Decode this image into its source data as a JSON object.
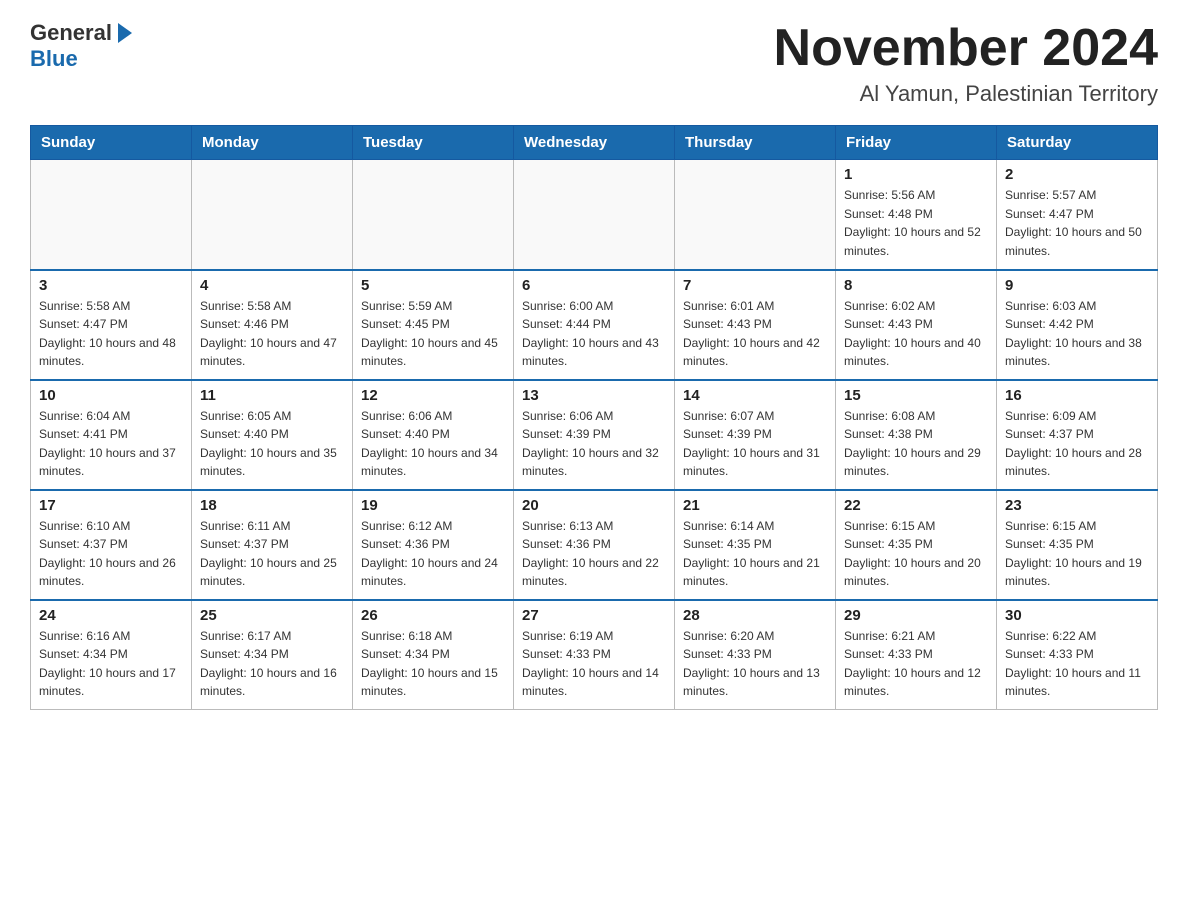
{
  "header": {
    "logo_text": "General",
    "logo_blue": "Blue",
    "month": "November 2024",
    "location": "Al Yamun, Palestinian Territory"
  },
  "days_of_week": [
    "Sunday",
    "Monday",
    "Tuesday",
    "Wednesday",
    "Thursday",
    "Friday",
    "Saturday"
  ],
  "weeks": [
    [
      {
        "day": "",
        "sunrise": "",
        "sunset": "",
        "daylight": ""
      },
      {
        "day": "",
        "sunrise": "",
        "sunset": "",
        "daylight": ""
      },
      {
        "day": "",
        "sunrise": "",
        "sunset": "",
        "daylight": ""
      },
      {
        "day": "",
        "sunrise": "",
        "sunset": "",
        "daylight": ""
      },
      {
        "day": "",
        "sunrise": "",
        "sunset": "",
        "daylight": ""
      },
      {
        "day": "1",
        "sunrise": "Sunrise: 5:56 AM",
        "sunset": "Sunset: 4:48 PM",
        "daylight": "Daylight: 10 hours and 52 minutes."
      },
      {
        "day": "2",
        "sunrise": "Sunrise: 5:57 AM",
        "sunset": "Sunset: 4:47 PM",
        "daylight": "Daylight: 10 hours and 50 minutes."
      }
    ],
    [
      {
        "day": "3",
        "sunrise": "Sunrise: 5:58 AM",
        "sunset": "Sunset: 4:47 PM",
        "daylight": "Daylight: 10 hours and 48 minutes."
      },
      {
        "day": "4",
        "sunrise": "Sunrise: 5:58 AM",
        "sunset": "Sunset: 4:46 PM",
        "daylight": "Daylight: 10 hours and 47 minutes."
      },
      {
        "day": "5",
        "sunrise": "Sunrise: 5:59 AM",
        "sunset": "Sunset: 4:45 PM",
        "daylight": "Daylight: 10 hours and 45 minutes."
      },
      {
        "day": "6",
        "sunrise": "Sunrise: 6:00 AM",
        "sunset": "Sunset: 4:44 PM",
        "daylight": "Daylight: 10 hours and 43 minutes."
      },
      {
        "day": "7",
        "sunrise": "Sunrise: 6:01 AM",
        "sunset": "Sunset: 4:43 PM",
        "daylight": "Daylight: 10 hours and 42 minutes."
      },
      {
        "day": "8",
        "sunrise": "Sunrise: 6:02 AM",
        "sunset": "Sunset: 4:43 PM",
        "daylight": "Daylight: 10 hours and 40 minutes."
      },
      {
        "day": "9",
        "sunrise": "Sunrise: 6:03 AM",
        "sunset": "Sunset: 4:42 PM",
        "daylight": "Daylight: 10 hours and 38 minutes."
      }
    ],
    [
      {
        "day": "10",
        "sunrise": "Sunrise: 6:04 AM",
        "sunset": "Sunset: 4:41 PM",
        "daylight": "Daylight: 10 hours and 37 minutes."
      },
      {
        "day": "11",
        "sunrise": "Sunrise: 6:05 AM",
        "sunset": "Sunset: 4:40 PM",
        "daylight": "Daylight: 10 hours and 35 minutes."
      },
      {
        "day": "12",
        "sunrise": "Sunrise: 6:06 AM",
        "sunset": "Sunset: 4:40 PM",
        "daylight": "Daylight: 10 hours and 34 minutes."
      },
      {
        "day": "13",
        "sunrise": "Sunrise: 6:06 AM",
        "sunset": "Sunset: 4:39 PM",
        "daylight": "Daylight: 10 hours and 32 minutes."
      },
      {
        "day": "14",
        "sunrise": "Sunrise: 6:07 AM",
        "sunset": "Sunset: 4:39 PM",
        "daylight": "Daylight: 10 hours and 31 minutes."
      },
      {
        "day": "15",
        "sunrise": "Sunrise: 6:08 AM",
        "sunset": "Sunset: 4:38 PM",
        "daylight": "Daylight: 10 hours and 29 minutes."
      },
      {
        "day": "16",
        "sunrise": "Sunrise: 6:09 AM",
        "sunset": "Sunset: 4:37 PM",
        "daylight": "Daylight: 10 hours and 28 minutes."
      }
    ],
    [
      {
        "day": "17",
        "sunrise": "Sunrise: 6:10 AM",
        "sunset": "Sunset: 4:37 PM",
        "daylight": "Daylight: 10 hours and 26 minutes."
      },
      {
        "day": "18",
        "sunrise": "Sunrise: 6:11 AM",
        "sunset": "Sunset: 4:37 PM",
        "daylight": "Daylight: 10 hours and 25 minutes."
      },
      {
        "day": "19",
        "sunrise": "Sunrise: 6:12 AM",
        "sunset": "Sunset: 4:36 PM",
        "daylight": "Daylight: 10 hours and 24 minutes."
      },
      {
        "day": "20",
        "sunrise": "Sunrise: 6:13 AM",
        "sunset": "Sunset: 4:36 PM",
        "daylight": "Daylight: 10 hours and 22 minutes."
      },
      {
        "day": "21",
        "sunrise": "Sunrise: 6:14 AM",
        "sunset": "Sunset: 4:35 PM",
        "daylight": "Daylight: 10 hours and 21 minutes."
      },
      {
        "day": "22",
        "sunrise": "Sunrise: 6:15 AM",
        "sunset": "Sunset: 4:35 PM",
        "daylight": "Daylight: 10 hours and 20 minutes."
      },
      {
        "day": "23",
        "sunrise": "Sunrise: 6:15 AM",
        "sunset": "Sunset: 4:35 PM",
        "daylight": "Daylight: 10 hours and 19 minutes."
      }
    ],
    [
      {
        "day": "24",
        "sunrise": "Sunrise: 6:16 AM",
        "sunset": "Sunset: 4:34 PM",
        "daylight": "Daylight: 10 hours and 17 minutes."
      },
      {
        "day": "25",
        "sunrise": "Sunrise: 6:17 AM",
        "sunset": "Sunset: 4:34 PM",
        "daylight": "Daylight: 10 hours and 16 minutes."
      },
      {
        "day": "26",
        "sunrise": "Sunrise: 6:18 AM",
        "sunset": "Sunset: 4:34 PM",
        "daylight": "Daylight: 10 hours and 15 minutes."
      },
      {
        "day": "27",
        "sunrise": "Sunrise: 6:19 AM",
        "sunset": "Sunset: 4:33 PM",
        "daylight": "Daylight: 10 hours and 14 minutes."
      },
      {
        "day": "28",
        "sunrise": "Sunrise: 6:20 AM",
        "sunset": "Sunset: 4:33 PM",
        "daylight": "Daylight: 10 hours and 13 minutes."
      },
      {
        "day": "29",
        "sunrise": "Sunrise: 6:21 AM",
        "sunset": "Sunset: 4:33 PM",
        "daylight": "Daylight: 10 hours and 12 minutes."
      },
      {
        "day": "30",
        "sunrise": "Sunrise: 6:22 AM",
        "sunset": "Sunset: 4:33 PM",
        "daylight": "Daylight: 10 hours and 11 minutes."
      }
    ]
  ]
}
